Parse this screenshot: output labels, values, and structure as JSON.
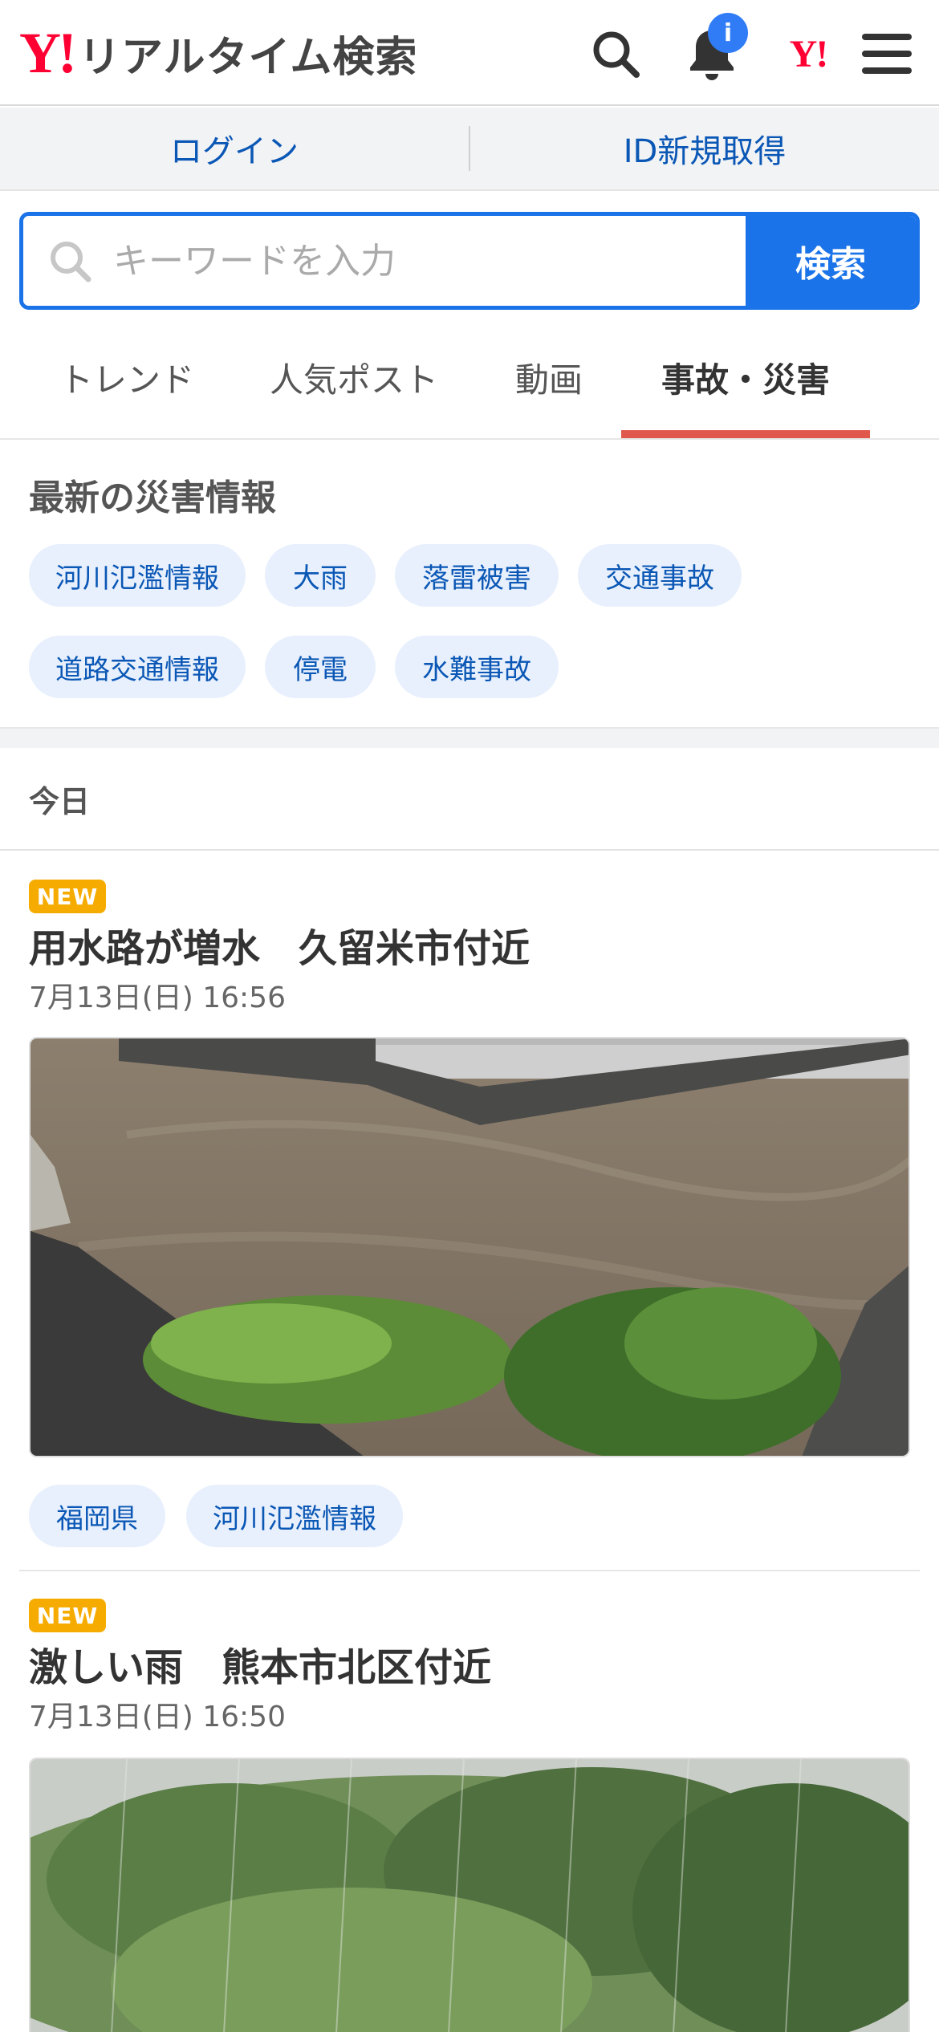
{
  "header": {
    "logo_mark": "Y!",
    "title": "リアルタイム検索",
    "notification_badge": "i",
    "yahoo_link_mark": "Y!"
  },
  "auth": {
    "login": "ログイン",
    "register": "ID新規取得"
  },
  "search": {
    "placeholder": "キーワードを入力",
    "button": "検索"
  },
  "tabs": [
    {
      "label": "トレンド"
    },
    {
      "label": "人気ポスト"
    },
    {
      "label": "動画"
    },
    {
      "label": "事故・災害",
      "active": true
    }
  ],
  "disaster_section": {
    "title": "最新の災害情報",
    "chips": [
      "河川氾濫情報",
      "大雨",
      "落雷被害",
      "交通事故",
      "道路交通情報",
      "停電",
      "水難事故"
    ]
  },
  "day_label": "今日",
  "posts": [
    {
      "badge": "NEW",
      "title": "用水路が増水　久留米市付近",
      "date": "7月13日(日) 16:56",
      "tags": [
        "福岡県",
        "河川氾濫情報"
      ]
    },
    {
      "badge": "NEW",
      "title": "激しい雨　熊本市北区付近",
      "date": "7月13日(日) 16:50"
    }
  ],
  "colors": {
    "brand_red": "#ff0033",
    "accent_blue": "#1a73e8",
    "tab_underline": "#e0584b",
    "new_badge": "#f6ab00"
  }
}
